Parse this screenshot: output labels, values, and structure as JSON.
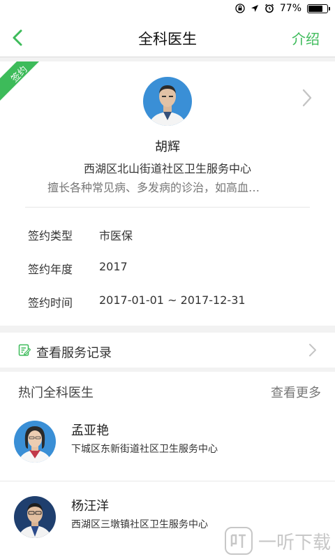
{
  "status_bar": {
    "battery_text": "77%",
    "battery_level": 0.77
  },
  "nav": {
    "title": "全科医生",
    "intro_label": "介绍"
  },
  "doctor": {
    "badge": "签约",
    "name": "胡辉",
    "org": "西湖区北山街道社区卫生服务中心",
    "specialty": "擅长各种常见病、多发病的诊治，如高血…"
  },
  "contract": {
    "type_label": "签约类型",
    "type_value": "市医保",
    "year_label": "签约年度",
    "year_value": "2017",
    "time_label": "签约时间",
    "time_value": "2017-01-01 ~ 2017-12-31"
  },
  "service": {
    "label": "查看服务记录"
  },
  "hot": {
    "title": "热门全科医生",
    "more_label": "查看更多",
    "doctors": [
      {
        "name": "孟亚艳",
        "org": "下城区东新街道社区卫生服务中心"
      },
      {
        "name": "杨汪洋",
        "org": "西湖区三墩镇社区卫生服务中心"
      }
    ]
  },
  "colors": {
    "accent": "#3dbb5a",
    "ribbon": "#3dbb5a"
  },
  "watermark": {
    "text": "一听下载"
  }
}
